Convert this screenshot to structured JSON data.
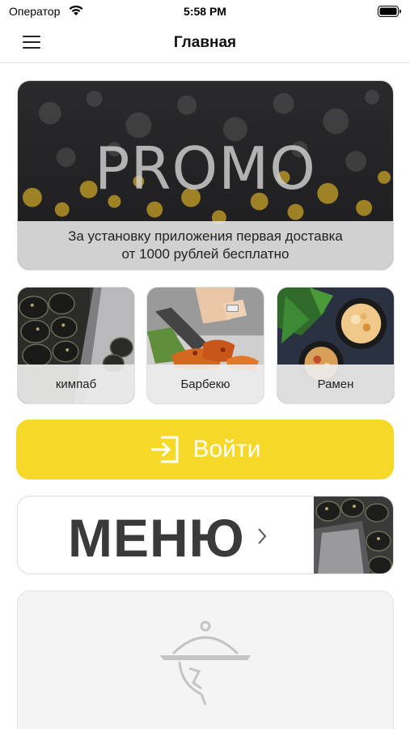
{
  "status_bar": {
    "carrier": "Оператор",
    "time": "5:58 PM",
    "icons": [
      "wifi-icon",
      "battery-icon"
    ]
  },
  "nav": {
    "title": "Главная",
    "menu_icon": "hamburger-menu-icon"
  },
  "promo": {
    "word": "PROMO",
    "caption_line1": "За установку приложения первая доставка",
    "caption_line2": "от 1000 рублей бесплатно"
  },
  "categories": [
    {
      "label": "кимпаб"
    },
    {
      "label": "Барбекю"
    },
    {
      "label": "Рамен"
    }
  ],
  "login": {
    "label": "Войти",
    "icon": "login-icon"
  },
  "menu_banner": {
    "label": "МЕНЮ",
    "icon": "chevron-right-icon"
  },
  "placeholder": {
    "icon": "cloche-icon"
  },
  "colors": {
    "accent_yellow": "#f6d928",
    "card_border": "#dcdcdc",
    "caption_bg": "#e1e1e1",
    "placeholder_bg": "#f4f4f4"
  }
}
